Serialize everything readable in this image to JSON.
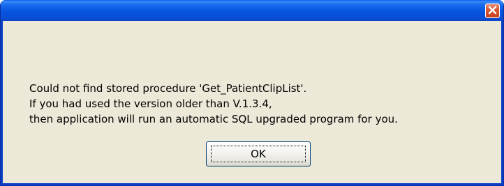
{
  "dialog": {
    "title": "",
    "message_lines": [
      "Could not find stored procedure 'Get_PatientClipList'.",
      "If you had used the version older than V.1.3.4,",
      "then application will run an automatic SQL upgraded program for you."
    ],
    "ok_label": "OK",
    "close_icon": "close-icon"
  },
  "colors": {
    "titlebar": "#0a5ae4",
    "close_button": "#d8502c",
    "client_background": "#ece9d8",
    "button_border": "#003c74"
  }
}
